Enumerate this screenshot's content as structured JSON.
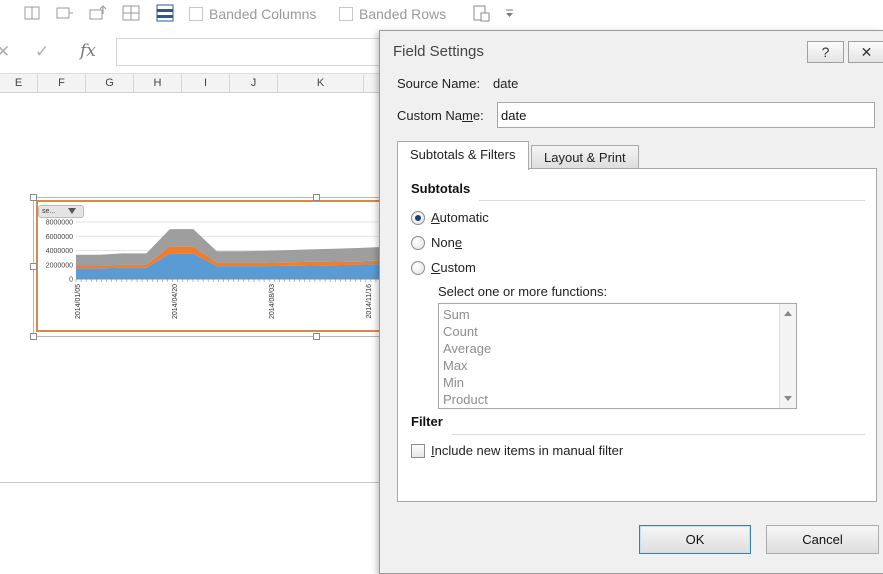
{
  "ribbon": {
    "banded_columns_label": "Banded Columns",
    "banded_rows_label": "Banded Rows"
  },
  "formula_bar": {
    "cancel_glyph": "✕",
    "enter_glyph": "✓",
    "fx_label": "fx"
  },
  "columns": [
    "E",
    "F",
    "G",
    "H",
    "I",
    "J",
    "K"
  ],
  "chart": {
    "filter_button_label": "se...",
    "y_tick_labels": [
      "8000000",
      "6000000",
      "4000000",
      "2000000",
      "0"
    ],
    "x_tick_labels": [
      "2014/01/05",
      "2014/04/20",
      "2014/08/03",
      "2014/11/16"
    ],
    "series_colors": [
      "#9e9e9e",
      "#ed7d31",
      "#5b9bd5"
    ]
  },
  "chart_data": {
    "type": "area",
    "stacked": true,
    "x": [
      "2014/01/05",
      "2014/02/02",
      "2014/03/02",
      "2014/03/30",
      "2014/04/06",
      "2014/04/20",
      "2014/05/04",
      "2014/06/01",
      "2014/07/06",
      "2014/08/03",
      "2014/09/07",
      "2014/10/05",
      "2014/11/16",
      "2014/12/28"
    ],
    "series": [
      {
        "values": [
          1500000,
          1500000,
          1600000,
          1600000,
          2400000,
          2400000,
          1600000,
          1600000,
          1650000,
          1700000,
          1750000,
          1800000,
          1850000,
          1900000
        ]
      },
      {
        "values": [
          400000,
          400000,
          400000,
          400000,
          1000000,
          1000000,
          500000,
          500000,
          500000,
          500000,
          500000,
          500000,
          500000,
          500000
        ]
      },
      {
        "values": [
          1500000,
          1500000,
          1600000,
          1600000,
          3600000,
          3600000,
          1800000,
          1800000,
          1800000,
          1850000,
          1900000,
          1950000,
          2000000,
          2100000
        ]
      }
    ],
    "y_ticks": [
      8000000,
      6000000,
      4000000,
      2000000,
      0
    ],
    "ylim": [
      0,
      8000000
    ],
    "grid": true,
    "legend": "none"
  },
  "dialog": {
    "title": "Field Settings",
    "help_glyph": "?",
    "close_glyph": "✕",
    "source_name_label": "Source Name:",
    "source_name_value": "date",
    "custom_name_label_pre": "Custom Na",
    "custom_name_label_key": "m",
    "custom_name_label_post": "e:",
    "custom_name_value": "date",
    "tabs": [
      "Subtotals & Filters",
      "Layout & Print"
    ],
    "subtotals_heading": "Subtotals",
    "radio_automatic": {
      "key": "A",
      "rest": "utomatic"
    },
    "radio_none": {
      "pre": "Non",
      "key": "e"
    },
    "radio_custom": {
      "key": "C",
      "rest": "ustom"
    },
    "functions_label": "Select one or more functions:",
    "functions": [
      "Sum",
      "Count",
      "Average",
      "Max",
      "Min",
      "Product"
    ],
    "filter_heading": "Filter",
    "include_new_items_label": {
      "key": "I",
      "rest": "nclude new items in manual filter"
    },
    "ok_label": "OK",
    "cancel_label": "Cancel"
  }
}
